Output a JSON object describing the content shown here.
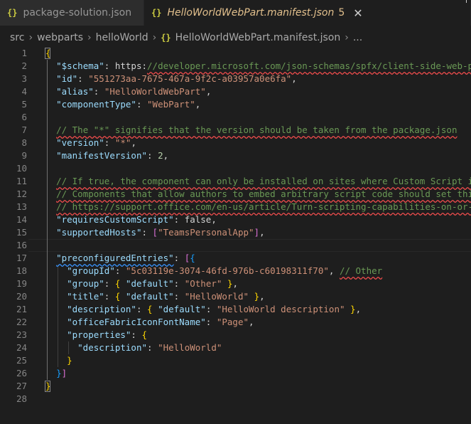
{
  "tabs": [
    {
      "icon": "{}",
      "label": "package-solution.json"
    },
    {
      "icon": "{}",
      "label": "HelloWorldWebPart.manifest.json",
      "problems": "5",
      "close": "✕"
    }
  ],
  "breadcrumb": [
    "src",
    "webparts",
    "helloWorld",
    "HelloWorldWebPart.manifest.json",
    "..."
  ],
  "breadcrumb_icon": "{}",
  "lines": [
    {
      "n": "1",
      "t": "{"
    },
    {
      "n": "2",
      "t": "  \"$schema\": \"https://developer.microsoft.com/json-schemas/spfx/client-side-web-pa"
    },
    {
      "n": "3",
      "t": "  \"id\": \"551273aa-7675-467a-9f2c-a03957a0e6fa\","
    },
    {
      "n": "4",
      "t": "  \"alias\": \"HelloWorldWebPart\","
    },
    {
      "n": "5",
      "t": "  \"componentType\": \"WebPart\","
    },
    {
      "n": "6",
      "t": ""
    },
    {
      "n": "7",
      "t": "  // The \"*\" signifies that the version should be taken from the package.json"
    },
    {
      "n": "8",
      "t": "  \"version\": \"*\","
    },
    {
      "n": "9",
      "t": "  \"manifestVersion\": 2,"
    },
    {
      "n": "10",
      "t": ""
    },
    {
      "n": "11",
      "t": "  // If true, the component can only be installed on sites where Custom Script is"
    },
    {
      "n": "12",
      "t": "  // Components that allow authors to embed arbitrary script code should set this"
    },
    {
      "n": "13",
      "t": "  // https://support.office.com/en-us/article/Turn-scripting-capabilities-on-or-of"
    },
    {
      "n": "14",
      "t": "  \"requiresCustomScript\": false,"
    },
    {
      "n": "15",
      "t": "  \"supportedHosts\": [\"TeamsPersonalApp\"],"
    },
    {
      "n": "16",
      "t": ""
    },
    {
      "n": "17",
      "t": "  \"preconfiguredEntries\": [{"
    },
    {
      "n": "18",
      "t": "    \"groupId\": \"5c03119e-3074-46fd-976b-c60198311f70\", // Other"
    },
    {
      "n": "19",
      "t": "    \"group\": { \"default\": \"Other\" },"
    },
    {
      "n": "20",
      "t": "    \"title\": { \"default\": \"HelloWorld\" },"
    },
    {
      "n": "21",
      "t": "    \"description\": { \"default\": \"HelloWorld description\" },"
    },
    {
      "n": "22",
      "t": "    \"officeFabricIconFontName\": \"Page\","
    },
    {
      "n": "23",
      "t": "    \"properties\": {"
    },
    {
      "n": "24",
      "t": "      \"description\": \"HelloWorld\""
    },
    {
      "n": "25",
      "t": "    }"
    },
    {
      "n": "26",
      "t": "  }]"
    },
    {
      "n": "27",
      "t": "}"
    },
    {
      "n": "28",
      "t": ""
    }
  ],
  "colors": {
    "background": "#1e1e1e",
    "key": "#9cdcfe",
    "string": "#ce9178",
    "keyword": "#4fc1ff",
    "number": "#b5cea8",
    "comment": "#6a9955",
    "tab_active_text": "#e2c08d"
  }
}
